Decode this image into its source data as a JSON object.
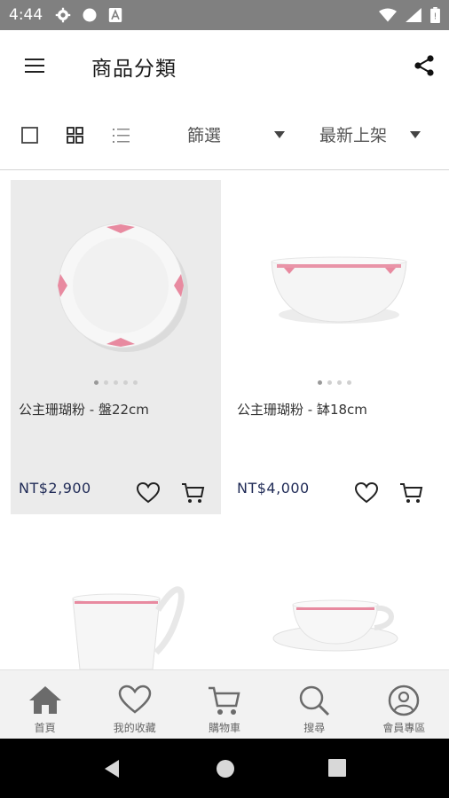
{
  "status_bar": {
    "time": "4:44"
  },
  "app_bar": {
    "title": "商品分類"
  },
  "toolbar": {
    "filter_label": "篩選",
    "sort_label": "最新上架"
  },
  "products": [
    {
      "name": "公主珊瑚粉 - 盤22cm",
      "price": "NT$2,900"
    },
    {
      "name": "公主珊瑚粉 - 缽18cm",
      "price": "NT$4,000"
    }
  ],
  "bottom_nav": {
    "home": "首頁",
    "favorites": "我的收藏",
    "cart": "購物車",
    "search": "搜尋",
    "member": "會員專區"
  },
  "colors": {
    "accent_pink": "#e88aa0",
    "price_navy": "#1f2a56",
    "status_bar": "#808080"
  }
}
